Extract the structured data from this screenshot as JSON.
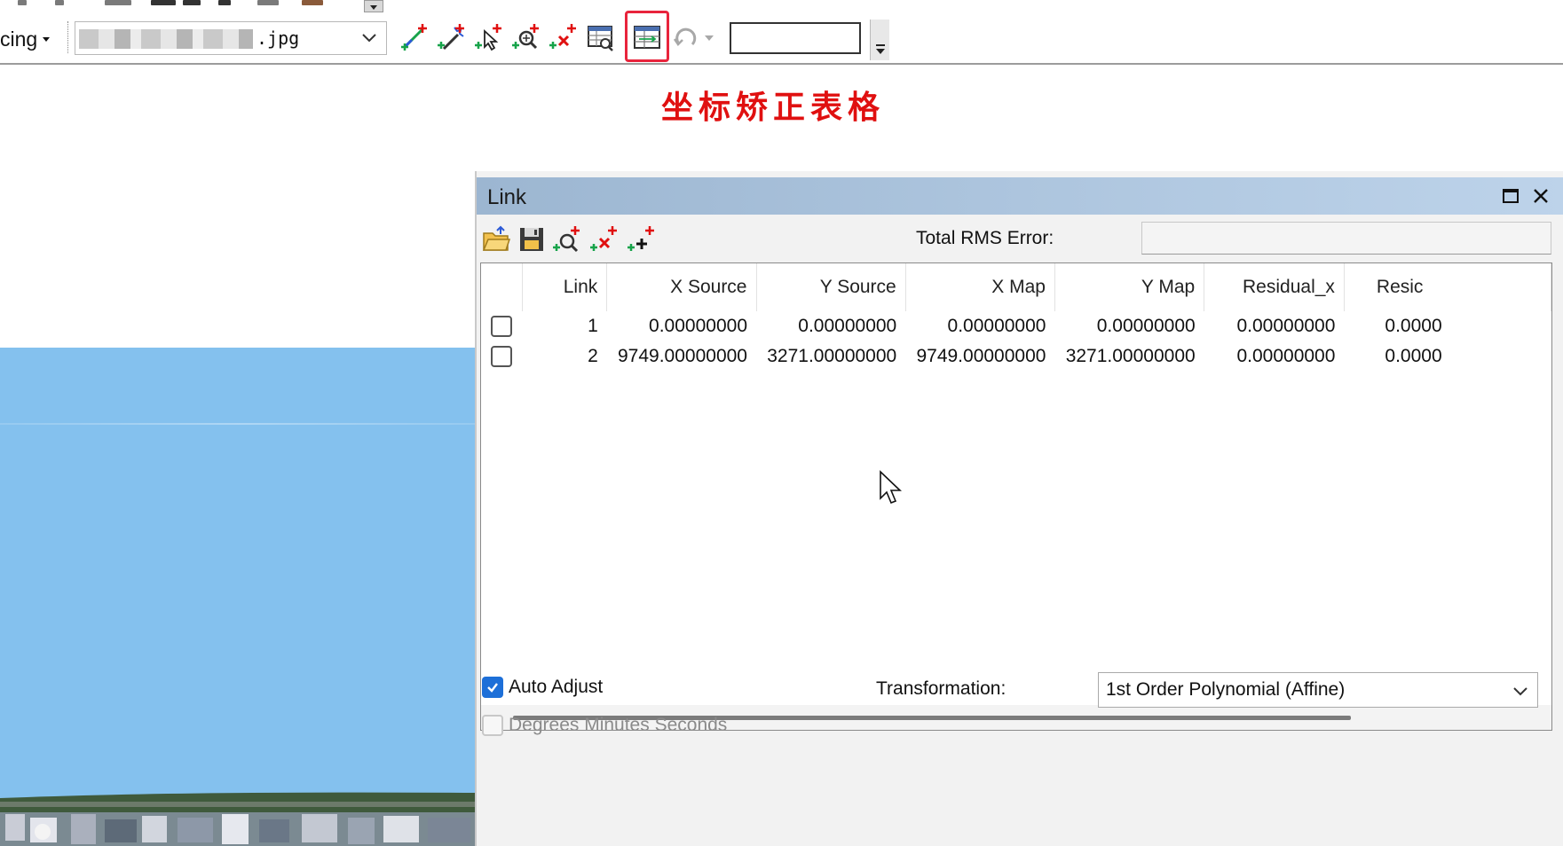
{
  "toolbar": {
    "georef_menu_label": "cing",
    "layer_combo_value": ".jpg",
    "icons": [
      "add-control-points-icon",
      "auto-registration-icon",
      "select-link-icon",
      "zoom-to-selected-link-icon",
      "delete-link-icon",
      "view-link-table-icon",
      "view-link-table-icon",
      "rotate-icon"
    ],
    "highlight_color": "#e8243c",
    "textbox_value": ""
  },
  "annotation": {
    "text": "坐标矫正表格",
    "color": "#e01010"
  },
  "link_window": {
    "title": "Link",
    "titlebar_color": "#a9c1da",
    "toolbar_icons": [
      "open-folder-icon",
      "save-icon",
      "zoom-link-icon",
      "delete-link-icon",
      "add-link-icon"
    ],
    "rms_label": "Total RMS Error:",
    "rms_value": "",
    "columns": [
      "Link",
      "X Source",
      "Y Source",
      "X Map",
      "Y Map",
      "Residual_x",
      "Resic"
    ],
    "rows": [
      {
        "link": "1",
        "x_source": "0.00000000",
        "y_source": "0.00000000",
        "x_map": "0.00000000",
        "y_map": "0.00000000",
        "residual_x": "0.00000000",
        "residual_y": "0.0000"
      },
      {
        "link": "2",
        "x_source": "9749.00000000",
        "y_source": "3271.00000000",
        "x_map": "9749.00000000",
        "y_map": "3271.00000000",
        "residual_x": "0.00000000",
        "residual_y": "0.0000"
      }
    ],
    "auto_adjust_label": "Auto Adjust",
    "auto_adjust_checked": true,
    "dms_label": "Degrees Minutes Seconds",
    "dms_checked": false,
    "transformation_label": "Transformation:",
    "transformation_value": "1st Order Polynomial (Affine)",
    "accent_color": "#1d6fd8"
  },
  "map": {
    "background_color": "#84c1ee"
  }
}
